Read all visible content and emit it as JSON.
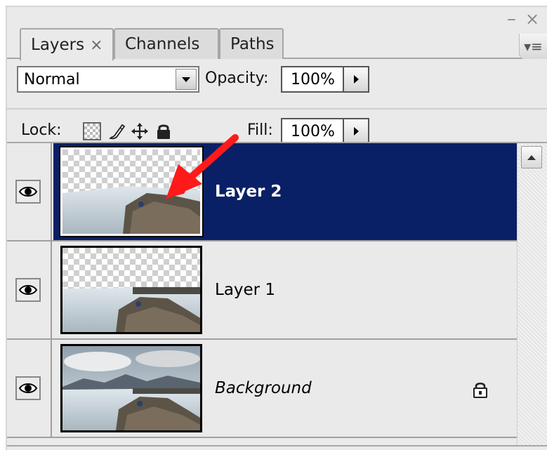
{
  "tabs": [
    {
      "label": "Layers",
      "close": "×",
      "active": true
    },
    {
      "label": "Channels",
      "active": false
    },
    {
      "label": "Paths",
      "active": false
    }
  ],
  "window_controls": {
    "minimize": "–",
    "close": "×"
  },
  "panel_menu_icon": "▾≡",
  "blend_mode": {
    "value": "Normal"
  },
  "opacity": {
    "label": "Opacity:",
    "value": "100%"
  },
  "lock": {
    "label": "Lock:",
    "icons": [
      "transparency-lock-icon",
      "brush-icon",
      "move-icon",
      "padlock-icon"
    ]
  },
  "fill": {
    "label": "Fill:",
    "value": "100%"
  },
  "layers": [
    {
      "name": "Layer 2",
      "selected": true,
      "visible": true,
      "locked": false
    },
    {
      "name": "Layer 1",
      "selected": false,
      "visible": true,
      "locked": false
    },
    {
      "name": "Background",
      "selected": false,
      "visible": true,
      "locked": true
    }
  ],
  "colors": {
    "selection": "#0a2066",
    "panel": "#eaeaea",
    "annotation_arrow": "#ff1a1a"
  }
}
